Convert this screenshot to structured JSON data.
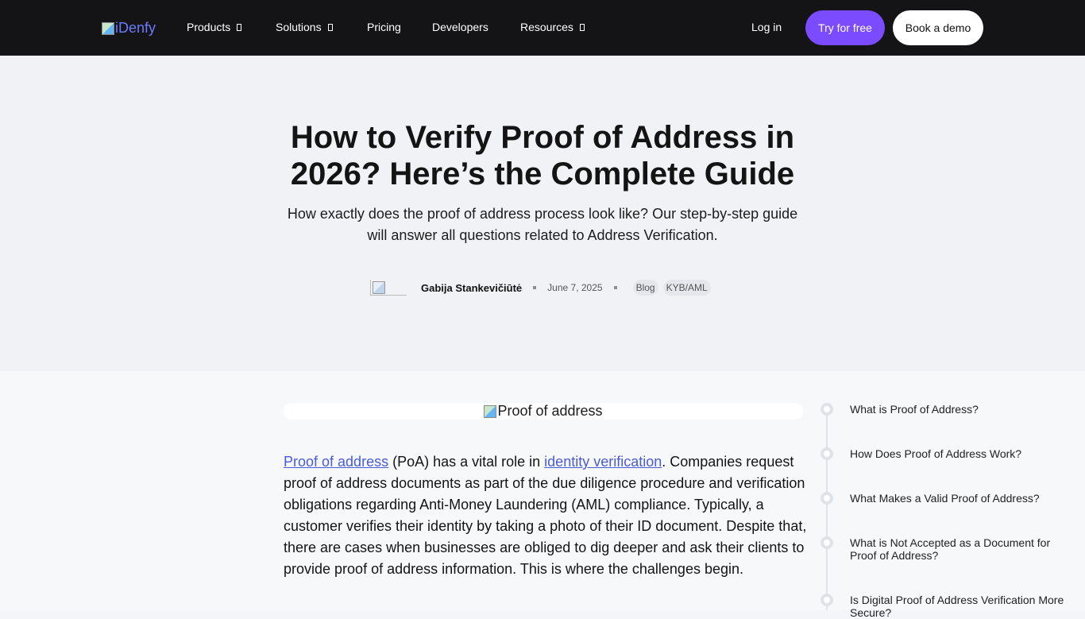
{
  "nav": {
    "logo_text": "iDenfy",
    "items": [
      "Products",
      "Solutions",
      "Pricing",
      "Developers",
      "Resources"
    ],
    "login": "Log in",
    "try_free": "Try for free",
    "book_demo": "Book a demo"
  },
  "hero": {
    "title": "How to Verify Proof of Address in 2026? Here’s the Complete Guide",
    "subtitle": "How exactly does the proof of address process look like? Our step-by-step guide will answer all questions related to Address Verification.",
    "author": "Gabija Stankevičiūtė",
    "date": "June 7, 2025",
    "tags": [
      "Blog",
      "KYB/AML"
    ]
  },
  "article": {
    "image_alt": "Proof of address",
    "link1": "Proof of address",
    "text1": " (PoA) has a vital role in ",
    "link2": "identity verification",
    "text2": ". Companies request proof of address documents as part of the due diligence procedure and verification obligations regarding Anti-Money Laundering (AML) compliance. Typically, a customer verifies their identity by taking a photo of their ID document. Despite that, there are cases when businesses are obliged to dig deeper and ask their clients to provide proof of address information. This is where the challenges begin."
  },
  "toc": [
    "What is Proof of Address?",
    "How Does Proof of Address Work?",
    "What Makes a Valid Proof of Address?",
    "What is Not Accepted as a Document for Proof of Address?",
    "Is Digital Proof of Address Verification More Secure?"
  ]
}
